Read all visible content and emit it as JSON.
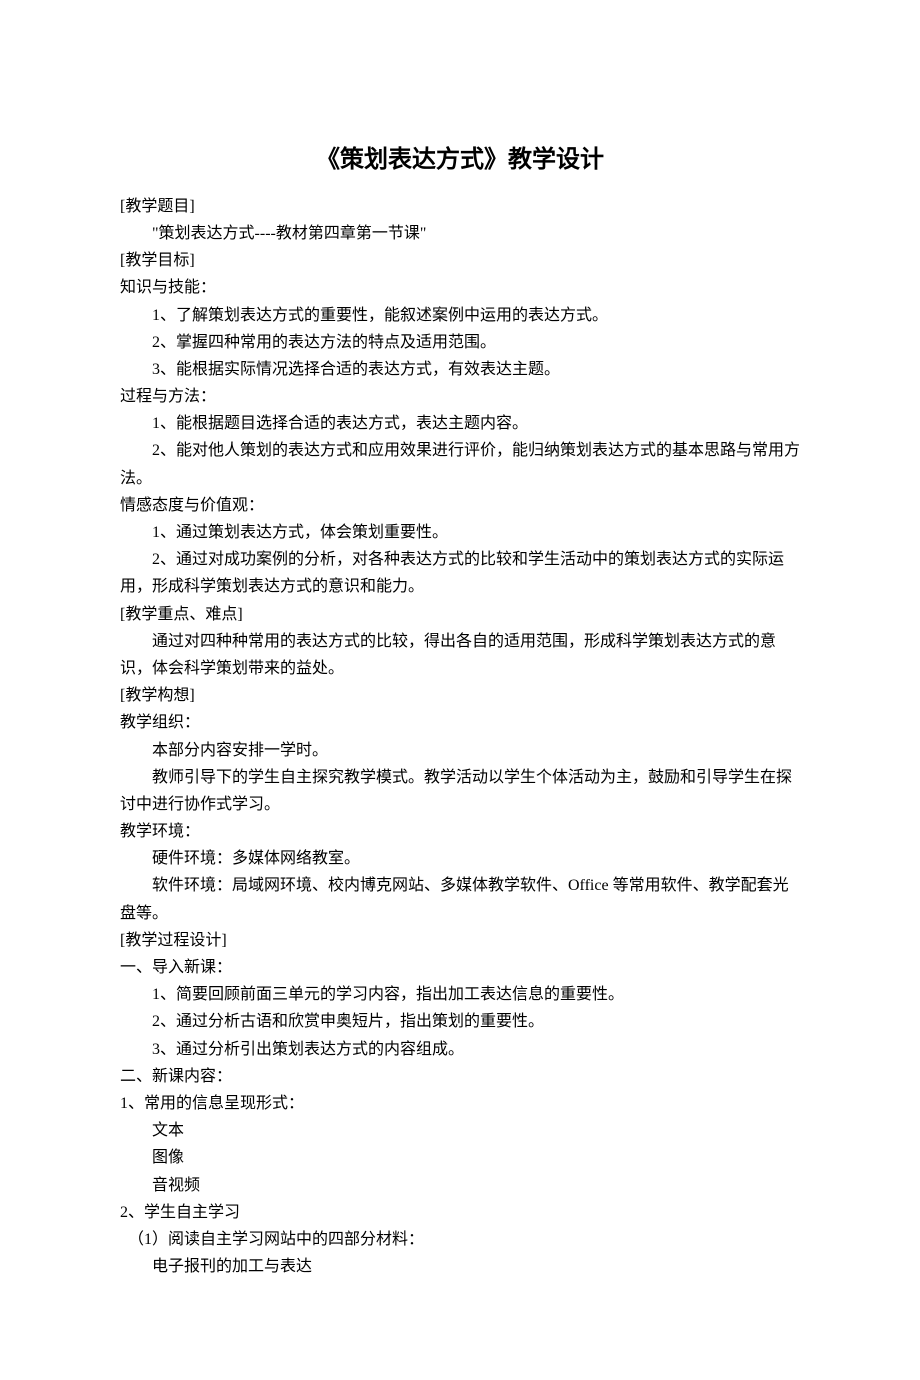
{
  "title": "《策划表达方式》教学设计",
  "sec1_label": "[教学题目]",
  "sec1_line1": "\"策划表达方式----教材第四章第一节课\"",
  "sec2_label": "[教学目标]",
  "sec2_sub1": "知识与技能：",
  "sec2_sub1_item1": "1、了解策划表达方式的重要性，能叙述案例中运用的表达方式。",
  "sec2_sub1_item2": "2、掌握四种常用的表达方法的特点及适用范围。",
  "sec2_sub1_item3": "3、能根据实际情况选择合适的表达方式，有效表达主题。",
  "sec2_sub2": "过程与方法：",
  "sec2_sub2_item1": "1、能根据题目选择合适的表达方式，表达主题内容。",
  "sec2_sub2_item2": "2、能对他人策划的表达方式和应用效果进行评价，能归纳策划表达方式的基本思路与常用方法。",
  "sec2_sub3": "情感态度与价值观：",
  "sec2_sub3_item1": "1、通过策划表达方式，体会策划重要性。",
  "sec2_sub3_item2": "2、通过对成功案例的分析，对各种表达方式的比较和学生活动中的策划表达方式的实际运用，形成科学策划表达方式的意识和能力。",
  "sec3_label": "[教学重点、难点]",
  "sec3_line1": "通过对四种种常用的表达方式的比较，得出各自的适用范围，形成科学策划表达方式的意识，体会科学策划带来的益处。",
  "sec4_label": "[教学构想]",
  "sec4_sub1": "教学组织：",
  "sec4_sub1_line1": "本部分内容安排一学时。",
  "sec4_sub1_line2": "教师引导下的学生自主探究教学模式。教学活动以学生个体活动为主，鼓励和引导学生在探讨中进行协作式学习。",
  "sec4_sub2": "教学环境：",
  "sec4_sub2_line1": "硬件环境：多媒体网络教室。",
  "sec4_sub2_line2": "软件环境：局域网环境、校内博克网站、多媒体教学软件、Office 等常用软件、教学配套光盘等。",
  "sec5_label": "[教学过程设计]",
  "sec5_sub1": "一、导入新课：",
  "sec5_sub1_item1": "1、简要回顾前面三单元的学习内容，指出加工表达信息的重要性。",
  "sec5_sub1_item2": "2、通过分析古语和欣赏申奥短片，指出策划的重要性。",
  "sec5_sub1_item3": "3、通过分析引出策划表达方式的内容组成。",
  "sec5_sub2": "二、新课内容：",
  "sec5_sub2_h1": "1、常用的信息呈现形式：",
  "sec5_sub2_h1_i1": "文本",
  "sec5_sub2_h1_i2": "图像",
  "sec5_sub2_h1_i3": "音视频",
  "sec5_sub2_h2": "2、学生自主学习",
  "sec5_sub2_h2_i1": "（1）阅读自主学习网站中的四部分材料：",
  "sec5_sub2_h2_i1a": "电子报刊的加工与表达"
}
